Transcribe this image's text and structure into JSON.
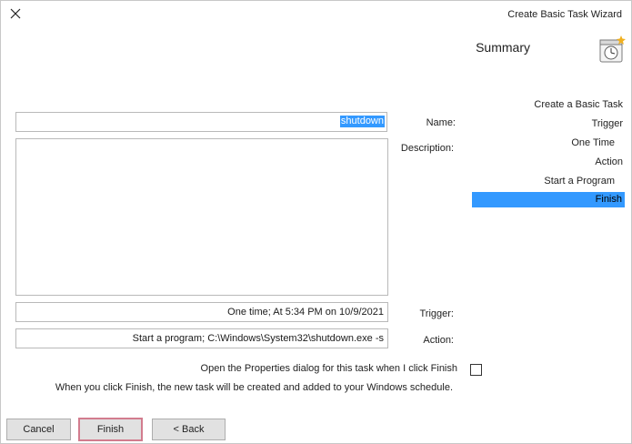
{
  "window": {
    "title": "Create Basic Task Wizard"
  },
  "header": {
    "title": "Summary",
    "icon": "task-clock-icon"
  },
  "nav": {
    "items": [
      {
        "label": "Create a Basic Task"
      },
      {
        "label": "Trigger"
      },
      {
        "label": "One Time"
      },
      {
        "label": "Action"
      },
      {
        "label": "Start a Program"
      },
      {
        "label": "Finish"
      }
    ],
    "selected": "Finish"
  },
  "form": {
    "name_label": "Name:",
    "name_value": "shutdown",
    "description_label": "Description:",
    "description_value": "",
    "trigger_label": "Trigger:",
    "trigger_value": "One time; At 5:34 PM on 10/9/2021",
    "action_label": "Action:",
    "action_value": "Start a program; C:\\Windows\\System32\\shutdown.exe -s"
  },
  "options": {
    "open_properties_label": "Open the Properties dialog for this task when I click Finish",
    "open_properties_checked": false,
    "info_text": "When you click Finish, the new task will be created and added to your Windows schedule."
  },
  "buttons": {
    "back": "< Back",
    "finish": "Finish",
    "cancel": "Cancel"
  },
  "colors": {
    "selection": "#3399ff",
    "finish_border": "#d27c8e"
  }
}
